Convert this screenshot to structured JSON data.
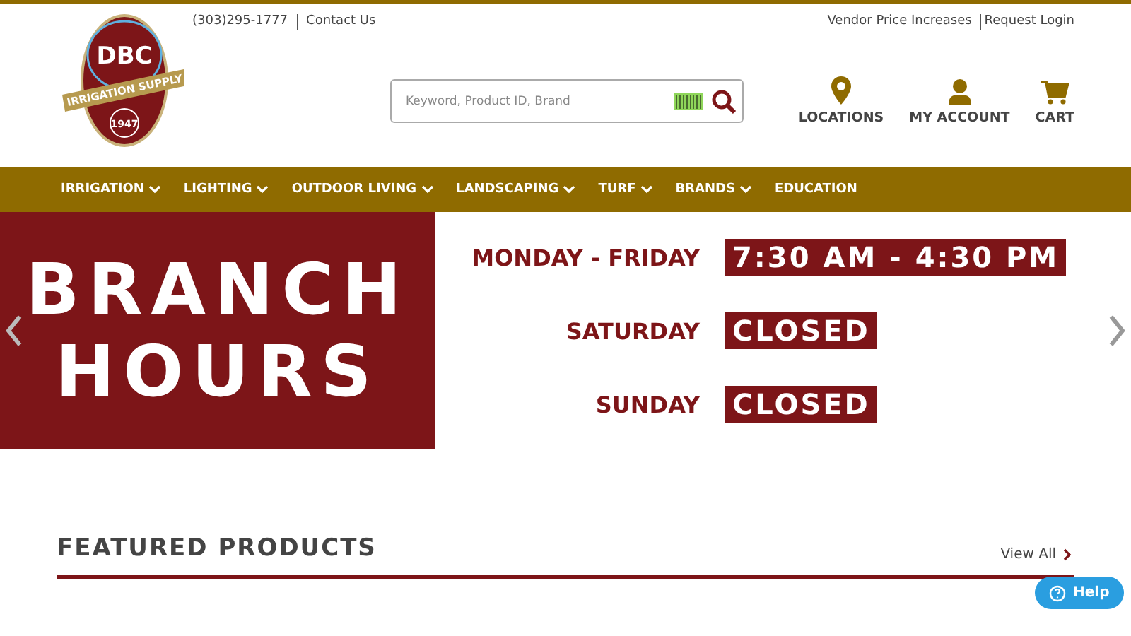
{
  "top_links_left": [
    "(303)295-1777",
    "Contact Us"
  ],
  "top_links_right": [
    "Vendor Price Increases",
    "Request Login"
  ],
  "logo": {
    "name": "DBC",
    "banner": "IRRIGATION SUPPLY",
    "year": "1947"
  },
  "search": {
    "placeholder": "Keyword, Product ID, Brand"
  },
  "header_actions": [
    {
      "label": "LOCATIONS",
      "kind": "pin"
    },
    {
      "label": "MY ACCOUNT",
      "kind": "person"
    },
    {
      "label": "CART",
      "kind": "cart"
    }
  ],
  "nav": [
    {
      "label": "IRRIGATION",
      "dropdown": true
    },
    {
      "label": "LIGHTING",
      "dropdown": true
    },
    {
      "label": "OUTDOOR LIVING",
      "dropdown": true
    },
    {
      "label": "LANDSCAPING",
      "dropdown": true
    },
    {
      "label": "TURF",
      "dropdown": true
    },
    {
      "label": "BRANDS",
      "dropdown": true
    },
    {
      "label": "EDUCATION",
      "dropdown": false
    }
  ],
  "banner": {
    "title_lines": [
      "BRANCH",
      "HOURS"
    ],
    "hours": [
      {
        "day": "MONDAY - FRIDAY",
        "time": "7:30 AM - 4:30 PM"
      },
      {
        "day": "SATURDAY",
        "time": "CLOSED"
      },
      {
        "day": "SUNDAY",
        "time": "CLOSED"
      }
    ]
  },
  "featured": {
    "title": "FEATURED PRODUCTS",
    "link": "View All"
  },
  "help": {
    "label": "Help"
  }
}
